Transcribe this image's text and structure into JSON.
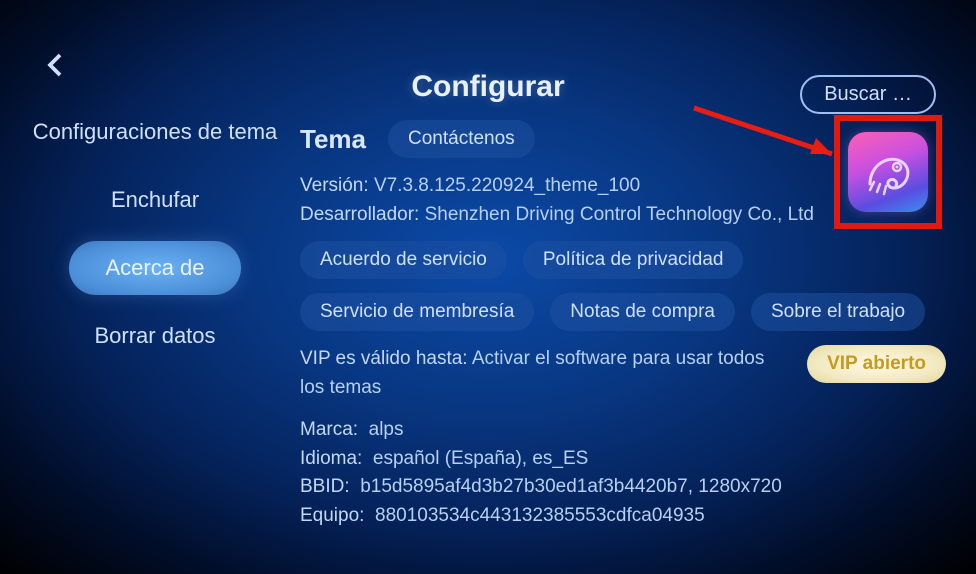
{
  "header": {
    "title": "Configurar",
    "search_label": "Buscar …"
  },
  "sidebar": {
    "items": [
      {
        "label": "Configuraciones de tema"
      },
      {
        "label": "Enchufar"
      },
      {
        "label": "Acerca de"
      },
      {
        "label": "Borrar datos"
      }
    ],
    "selected_index": 2
  },
  "about": {
    "section_heading": "Tema",
    "contact_label": "Contáctenos",
    "version_label": "Versión:",
    "version_value": "V7.3.8.125.220924_theme_100",
    "developer_label": "Desarrollador:",
    "developer_value": "Shenzhen Driving Control Technology Co., Ltd",
    "buttons": {
      "service_agreement": "Acuerdo de servicio",
      "privacy_policy": "Política de privacidad",
      "membership_service": "Servicio de membresía",
      "purchase_notes": "Notas de compra",
      "about_work": "Sobre el trabajo"
    },
    "vip_valid_label": "VIP es válido hasta:",
    "vip_valid_value": "Activar el software para usar todos los temas",
    "vip_open_label": "VIP abierto",
    "brand_label": "Marca:",
    "brand_value": "alps",
    "language_label": "Idioma:",
    "language_value": "español (España), es_ES",
    "bbid_label": "BBID:",
    "bbid_value": "b15d5895af4d3b27b30ed1af3b4420b7, 1280x720",
    "device_label": "Equipo:",
    "device_value": "880103534c443132385553cdfca04935"
  },
  "icons": {
    "back": "chevron-left-icon",
    "app_icon": "chameleon-icon"
  },
  "annotations": {
    "highlight_color": "#e11a0f",
    "arrow_target": "app-icon"
  }
}
